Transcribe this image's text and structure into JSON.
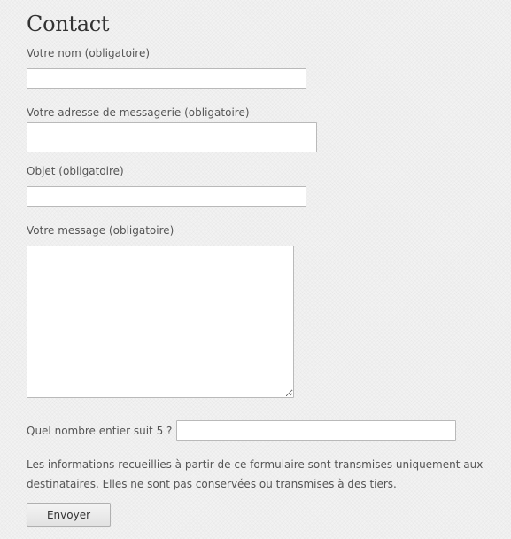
{
  "page": {
    "title": "Contact"
  },
  "form": {
    "name": {
      "label": "Votre nom (obligatoire)",
      "value": ""
    },
    "email": {
      "label": "Votre adresse de messagerie (obligatoire)",
      "value": ""
    },
    "subject": {
      "label": "Objet (obligatoire)",
      "value": ""
    },
    "message": {
      "label": "Votre message (obligatoire)",
      "value": ""
    },
    "captcha": {
      "question": "Quel nombre entier suit 5 ?",
      "value": ""
    },
    "notice": "Les informations recueillies à partir de ce formulaire sont transmises uniquement aux destinataires. Elles ne sont pas conservées ou transmises à des tiers.",
    "submit_label": "Envoyer"
  }
}
